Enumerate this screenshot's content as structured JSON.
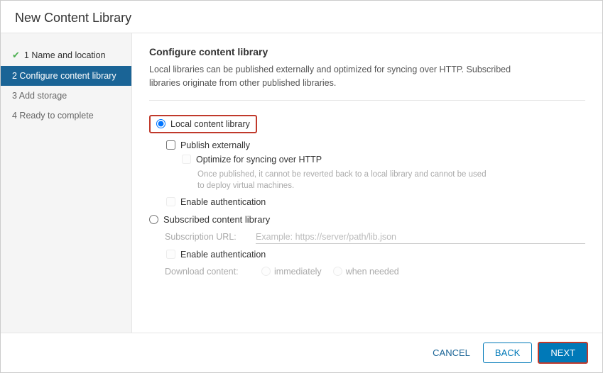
{
  "dialog": {
    "title": "New Content Library"
  },
  "sidebar": {
    "items": [
      {
        "id": "step1",
        "label": "1 Name and location",
        "state": "completed"
      },
      {
        "id": "step2",
        "label": "2 Configure content library",
        "state": "active"
      },
      {
        "id": "step3",
        "label": "3 Add storage",
        "state": "pending"
      },
      {
        "id": "step4",
        "label": "4 Ready to complete",
        "state": "pending"
      }
    ]
  },
  "main": {
    "section_title": "Configure content library",
    "section_desc1": "Local libraries can be published externally and optimized for syncing over HTTP. Subscribed",
    "section_desc2": "libraries originate from other published libraries.",
    "local_library_label": "Local content library",
    "publish_externally_label": "Publish externally",
    "optimize_http_label": "Optimize for syncing over HTTP",
    "once_published_desc": "Once published, it cannot be reverted back to a local library and cannot be used",
    "to_deploy_desc": "to deploy virtual machines.",
    "enable_auth_local_label": "Enable authentication",
    "subscribed_library_label": "Subscribed content library",
    "subscription_url_label": "Subscription URL:",
    "subscription_url_placeholder": "Example: https://server/path/lib.json",
    "enable_auth_sub_label": "Enable authentication",
    "download_content_label": "Download content:",
    "immediately_label": "immediately",
    "when_needed_label": "when needed"
  },
  "footer": {
    "cancel_label": "CANCEL",
    "back_label": "BACK",
    "next_label": "NEXT"
  }
}
